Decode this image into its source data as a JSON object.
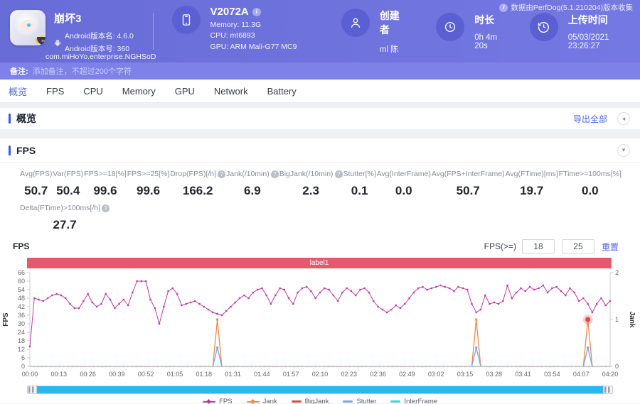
{
  "header": {
    "app": {
      "icon_name": "honkai3-app-icon",
      "icon_badge": "miHoYo",
      "title": "崩坏3",
      "android_ver": "Android版本名: 4.6.0",
      "android_build": "Android版本号: 360",
      "package": "com.miHoYo.enterprise.NGHSoD"
    },
    "device": {
      "model": "V2072A",
      "memory": "Memory: 11.3G",
      "cpu": "CPU: mt6893",
      "gpu": "GPU: ARM Mali-G77 MC9"
    },
    "creator": {
      "label": "创建者",
      "value": "ml 陈"
    },
    "duration": {
      "label": "时长",
      "value": "0h 4m 20s"
    },
    "upload": {
      "label": "上传时间",
      "value": "05/03/2021 23:26:27"
    },
    "source_note": "数据由PerfDog(5.1.210204)版本收集"
  },
  "note_bar": {
    "label": "备注:",
    "placeholder": "添加备注，不超过200个字符"
  },
  "tabs": [
    {
      "label": "概览",
      "active": true
    },
    {
      "label": "FPS",
      "active": false
    },
    {
      "label": "CPU",
      "active": false
    },
    {
      "label": "Memory",
      "active": false
    },
    {
      "label": "GPU",
      "active": false
    },
    {
      "label": "Network",
      "active": false
    },
    {
      "label": "Battery",
      "active": false
    }
  ],
  "overview_section": {
    "title": "概览",
    "export_label": "导出全部"
  },
  "fps_section": {
    "title": "FPS",
    "chart_title": "FPS",
    "threshold": {
      "label": "FPS(>=)",
      "low": "18",
      "high": "25",
      "reset_label": "重置"
    },
    "band_label": "label1",
    "stats": [
      {
        "label": "Avg(FPS)",
        "value": "50.7",
        "help": false
      },
      {
        "label": "Var(FPS)",
        "value": "50.4",
        "help": false
      },
      {
        "label": "FPS>=18[%]",
        "value": "99.6",
        "help": false
      },
      {
        "label": "FPS>=25[%]",
        "value": "99.6",
        "help": false
      },
      {
        "label": "Drop(FPS)[/h]",
        "value": "166.2",
        "help": true
      },
      {
        "label": "Jank(/10min)",
        "value": "6.9",
        "help": true
      },
      {
        "label": "BigJank(/10min)",
        "value": "2.3",
        "help": true
      },
      {
        "label": "Stutter[%]",
        "value": "0.1",
        "help": false
      },
      {
        "label": "Avg(InterFrame)",
        "value": "0.0",
        "help": false
      },
      {
        "label": "Avg(FPS+InterFrame)",
        "value": "50.7",
        "help": false
      },
      {
        "label": "Avg(FTime)[ms]",
        "value": "19.7",
        "help": false
      },
      {
        "label": "FTime>=100ms[%]",
        "value": "0.0",
        "help": false
      }
    ],
    "stats_row2": [
      {
        "label": "Delta(FTime)>100ms[/h]",
        "value": "27.7",
        "help": true
      }
    ]
  },
  "chart_data": {
    "type": "line",
    "title": "label1",
    "ylabel": "FPS",
    "y2label": "Jank",
    "ylim": [
      0,
      66
    ],
    "y_ticks": [
      0,
      6,
      12,
      18,
      24,
      30,
      36,
      42,
      48,
      54,
      60,
      66
    ],
    "y2lim": [
      0,
      2
    ],
    "y2_ticks": [
      0,
      1,
      2
    ],
    "x_range_seconds": [
      0,
      260
    ],
    "x_tick_labels": [
      "00:00",
      "00:13",
      "00:26",
      "00:39",
      "00:52",
      "01:05",
      "01:18",
      "01:31",
      "01:44",
      "01:57",
      "02:10",
      "02:23",
      "02:36",
      "02:49",
      "03:02",
      "03:15",
      "03:28",
      "03:41",
      "03:54",
      "04:07",
      "04:20"
    ],
    "sample_interval_s": 2,
    "grid": false,
    "legend_position": "bottom",
    "series": [
      {
        "name": "FPS",
        "color": "#bf3ba5",
        "axis": "y",
        "marker": "square",
        "legend_marker": "line-diamond",
        "values": [
          14,
          48,
          47,
          46,
          48,
          50,
          51,
          50,
          48,
          44,
          41,
          41,
          46,
          51,
          45,
          42,
          44,
          51,
          47,
          41,
          44,
          47,
          43,
          52,
          60,
          60,
          60,
          47,
          41,
          30,
          42,
          53,
          55,
          51,
          43,
          44,
          45,
          46,
          44,
          42,
          40,
          38,
          37,
          36,
          39,
          42,
          45,
          48,
          50,
          48,
          52,
          54,
          55,
          50,
          44,
          50,
          55,
          54,
          48,
          44,
          52,
          55,
          56,
          53,
          48,
          52,
          55,
          54,
          50,
          46,
          52,
          55,
          53,
          50,
          54,
          55,
          52,
          46,
          42,
          40,
          38,
          40,
          43,
          41,
          44,
          48,
          52,
          55,
          56,
          54,
          55,
          56,
          57,
          56,
          55,
          53,
          56,
          55,
          54,
          44,
          38,
          40,
          50,
          44,
          45,
          44,
          46,
          57,
          48,
          52,
          55,
          53,
          56,
          54,
          55,
          57,
          52,
          55,
          56,
          53,
          50,
          55,
          52,
          46,
          48,
          44,
          38,
          44,
          48,
          43,
          46
        ]
      },
      {
        "name": "Jank",
        "color": "#f08844",
        "axis": "y2",
        "legend_marker": "line-diamond",
        "baseline": 0,
        "spikes": [
          {
            "t": 84,
            "v": 1
          },
          {
            "t": 200,
            "v": 1
          },
          {
            "t": 250,
            "v": 1
          }
        ]
      },
      {
        "name": "BigJank",
        "color": "#e04848",
        "axis": "y2",
        "legend_marker": "dash",
        "baseline": 0,
        "spikes": []
      },
      {
        "name": "Stutter",
        "color": "#78a6e8",
        "axis": "y2",
        "legend_marker": "dash",
        "baseline": 0,
        "spikes": [
          {
            "t": 84,
            "v": 0.4
          },
          {
            "t": 200,
            "v": 0.4
          },
          {
            "t": 250,
            "v": 0.4
          }
        ]
      },
      {
        "name": "InterFrame",
        "color": "#3ed2e0",
        "axis": "y2",
        "legend_marker": "dash",
        "baseline": 0,
        "spikes": []
      }
    ],
    "highlight": {
      "series": "Jank",
      "t": 250,
      "v": 1,
      "color": "#e04848"
    }
  },
  "colors": {
    "header_bg": "#6d70da",
    "header_circle": "#5a5fd2",
    "note_bar_bg": "#7d81e8",
    "accent_blue": "#4d68e6",
    "section_bar": "#3a5ae8",
    "band_red": "#e45a6d",
    "scrollbar_blue": "#29b7f3",
    "stat_value": "#24272e",
    "stat_label": "#878c96"
  }
}
